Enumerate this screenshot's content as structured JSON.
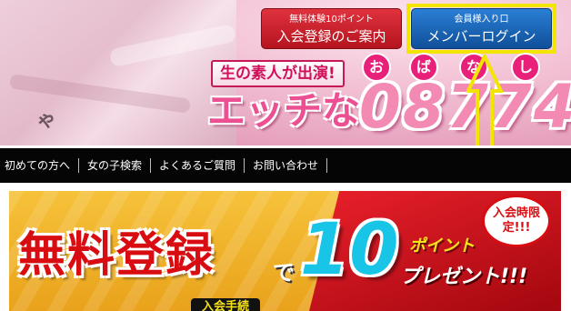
{
  "header": {
    "register_button": {
      "small": "無料体験10ポイント",
      "big": "入会登録のご案内"
    },
    "login_button": {
      "small": "会員様入り口",
      "big": "メンバーログイン"
    },
    "logo": {
      "tagline": "生の素人が出演!",
      "main_text": "エッチな",
      "number": "08774",
      "kana_above": [
        "お",
        "ば",
        "な",
        "し"
      ]
    },
    "shirt_print": "ゃ"
  },
  "nav": {
    "items": [
      "初めての方へ",
      "女の子検索",
      "よくあるご質問",
      "お問い合わせ"
    ]
  },
  "banner": {
    "title": "無料登録",
    "de": "で",
    "number": "10",
    "point": "ポイント",
    "present": "プレゼント!!!",
    "badge": "入会時限定!!!",
    "sub": "入会手続"
  },
  "colors": {
    "register_red": "#c81d27",
    "login_blue": "#1a64b8",
    "highlight_yellow": "#f2e500",
    "nav_black": "#050505"
  },
  "icons": {
    "annotation_arrow": "up-arrow-icon"
  }
}
